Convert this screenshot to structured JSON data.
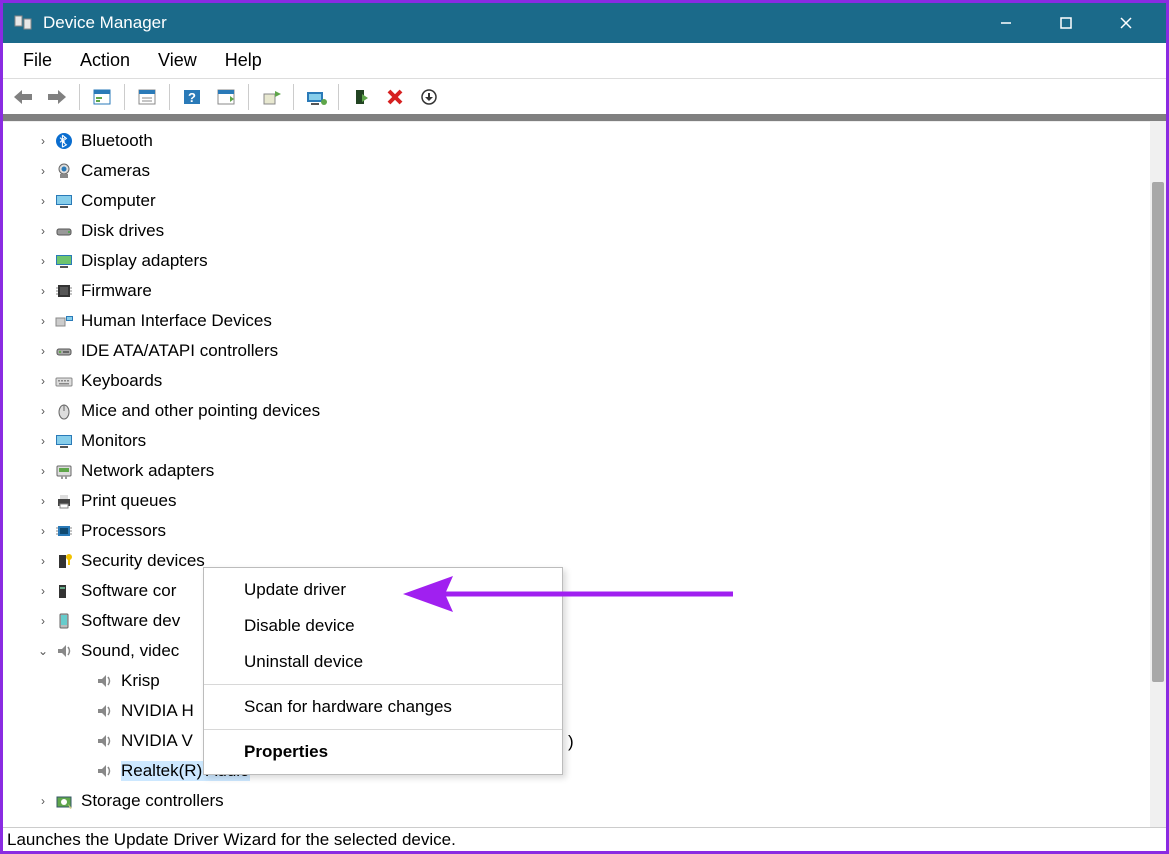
{
  "window": {
    "title": "Device Manager"
  },
  "menubar": {
    "items": [
      "File",
      "Action",
      "View",
      "Help"
    ]
  },
  "toolbar": {
    "back": "back-icon",
    "forward": "forward-icon",
    "show_hidden": "show-hidden-icon",
    "properties": "properties-icon",
    "help": "help-icon",
    "view_devices": "view-devices-icon",
    "update": "update-driver-icon",
    "scan": "scan-hardware-icon",
    "add": "add-device-icon",
    "remove": "remove-device-icon",
    "down": "down-arrow-icon"
  },
  "tree": {
    "categories": [
      {
        "label": "Bluetooth",
        "icon": "bluetooth-icon",
        "expandable": true
      },
      {
        "label": "Cameras",
        "icon": "camera-icon",
        "expandable": true
      },
      {
        "label": "Computer",
        "icon": "computer-icon",
        "expandable": true
      },
      {
        "label": "Disk drives",
        "icon": "disk-icon",
        "expandable": true
      },
      {
        "label": "Display adapters",
        "icon": "display-adapter-icon",
        "expandable": true
      },
      {
        "label": "Firmware",
        "icon": "firmware-icon",
        "expandable": true
      },
      {
        "label": "Human Interface Devices",
        "icon": "hid-icon",
        "expandable": true
      },
      {
        "label": "IDE ATA/ATAPI controllers",
        "icon": "ide-icon",
        "expandable": true
      },
      {
        "label": "Keyboards",
        "icon": "keyboard-icon",
        "expandable": true
      },
      {
        "label": "Mice and other pointing devices",
        "icon": "mouse-icon",
        "expandable": true
      },
      {
        "label": "Monitors",
        "icon": "monitor-icon",
        "expandable": true
      },
      {
        "label": "Network adapters",
        "icon": "network-icon",
        "expandable": true
      },
      {
        "label": "Print queues",
        "icon": "printer-icon",
        "expandable": true
      },
      {
        "label": "Processors",
        "icon": "processor-icon",
        "expandable": true
      },
      {
        "label": "Security devices",
        "icon": "security-icon",
        "expandable": true
      },
      {
        "label": "Software cor",
        "icon": "software-icon",
        "expandable": true,
        "truncated": true
      },
      {
        "label": "Software dev",
        "icon": "software-dev-icon",
        "expandable": true,
        "truncated": true
      },
      {
        "label": "Sound, videc",
        "icon": "sound-icon",
        "expandable": true,
        "expanded": true,
        "truncated": true
      }
    ],
    "sound_children": [
      {
        "label": "Krisp",
        "icon": "audio-device-icon"
      },
      {
        "label": "NVIDIA H",
        "icon": "audio-device-icon",
        "truncated": true
      },
      {
        "label": "NVIDIA V",
        "icon": "audio-device-icon",
        "truncated": true
      },
      {
        "label": "Realtek(R) Audio",
        "icon": "audio-device-icon",
        "selected": true
      }
    ],
    "storage": {
      "label": "Storage controllers",
      "icon": "storage-icon",
      "expandable": true
    }
  },
  "context_menu": {
    "items": [
      {
        "label": "Update driver",
        "type": "item"
      },
      {
        "label": "Disable device",
        "type": "item"
      },
      {
        "label": "Uninstall device",
        "type": "item"
      },
      {
        "type": "sep"
      },
      {
        "label": "Scan for hardware changes",
        "type": "item"
      },
      {
        "type": "sep"
      },
      {
        "label": "Properties",
        "type": "item",
        "bold": true
      }
    ]
  },
  "statusbar": {
    "text": "Launches the Update Driver Wizard for the selected device."
  },
  "stray": {
    "paren": ")"
  }
}
